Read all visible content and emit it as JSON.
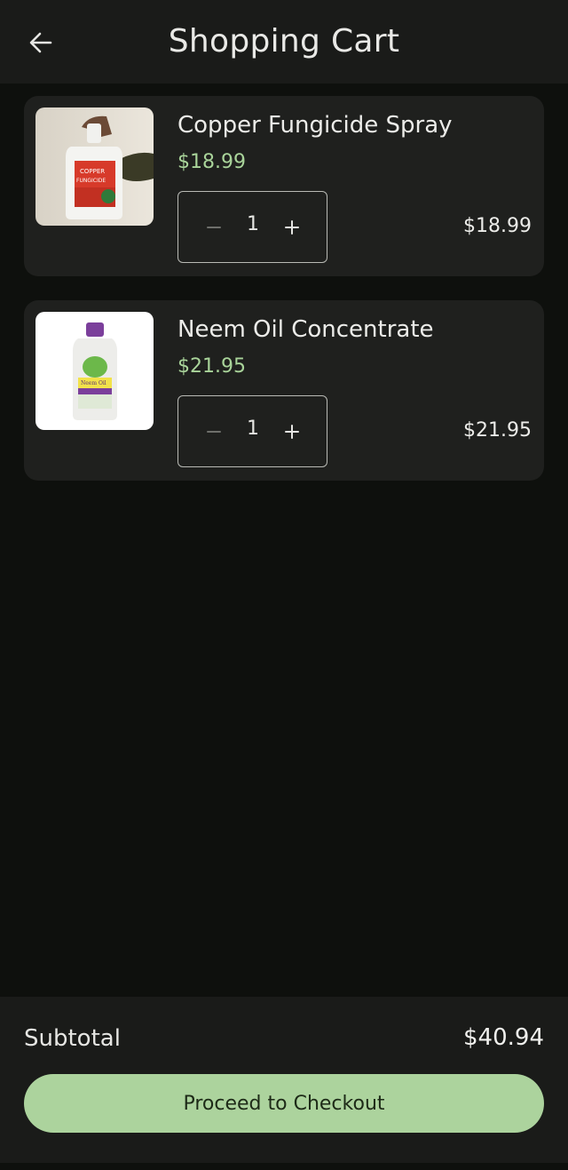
{
  "header": {
    "title": "Shopping Cart",
    "back_icon": "arrow-left-icon"
  },
  "cart": {
    "items": [
      {
        "name": "Copper Fungicide Spray",
        "price": "$18.99",
        "quantity": "1",
        "line_total": "$18.99",
        "image": "copper-fungicide-bottle"
      },
      {
        "name": "Neem Oil Concentrate",
        "price": "$21.95",
        "quantity": "1",
        "line_total": "$21.95",
        "image": "neem-oil-bottle"
      }
    ]
  },
  "summary": {
    "subtotal_label": "Subtotal",
    "subtotal_value": "$40.94",
    "checkout_label": "Proceed to Checkout"
  },
  "colors": {
    "accent": "#acd39d",
    "price_green": "#a9d49a",
    "background": "#0e100d",
    "card": "#1f201e"
  }
}
